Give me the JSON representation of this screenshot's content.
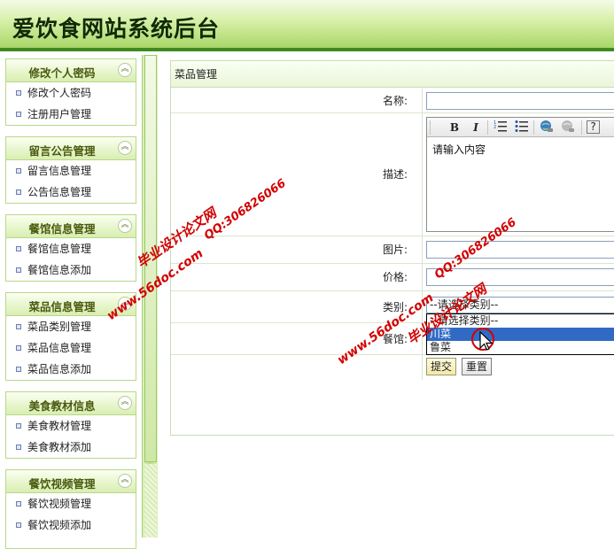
{
  "header": {
    "title": "爱饮食网站系统后台"
  },
  "sidebar": {
    "groups": [
      {
        "title": "修改个人密码",
        "items": [
          "修改个人密码",
          "注册用户管理"
        ]
      },
      {
        "title": "留言公告管理",
        "items": [
          "留言信息管理",
          "公告信息管理"
        ]
      },
      {
        "title": "餐馆信息管理",
        "items": [
          "餐馆信息管理",
          "餐馆信息添加"
        ]
      },
      {
        "title": "菜品信息管理",
        "items": [
          "菜品类别管理",
          "菜品信息管理",
          "菜品信息添加"
        ]
      },
      {
        "title": "美食教材信息",
        "items": [
          "美食教材管理",
          "美食教材添加"
        ]
      },
      {
        "title": "餐饮视频管理",
        "items": [
          "餐饮视频管理",
          "餐饮视频添加"
        ]
      }
    ],
    "toggle_glyph": "︽"
  },
  "form": {
    "panel_title": "菜品管理",
    "name_label": "名称:",
    "desc_label": "描述:",
    "desc_placeholder": "请输入内容",
    "image_label": "图片:",
    "price_label": "价格:",
    "category_label": "类别:",
    "category_selected": "--请选择类别--",
    "category_options": [
      "--请选择类别--",
      "川菜",
      "鲁菜"
    ],
    "category_highlighted_index": 1,
    "restaurant_label": "餐馆:",
    "submit_label": "提交",
    "reset_label": "重置"
  },
  "editor": {
    "toolbar": {
      "bold": "B",
      "italic": "I",
      "icons": [
        "ordered-list-icon",
        "unordered-list-icon",
        "insert-link-icon",
        "remove-link-icon",
        "help-icon"
      ],
      "help": "?"
    }
  },
  "watermark": {
    "line1": "毕业设计论文网",
    "line2": "www.56doc.com",
    "line3": "QQ:306826066"
  },
  "colors": {
    "header_border": "#3f8a1e",
    "menu_title": "#4a5a10",
    "selected_option": "#316ac5",
    "watermark": "#d20000"
  }
}
